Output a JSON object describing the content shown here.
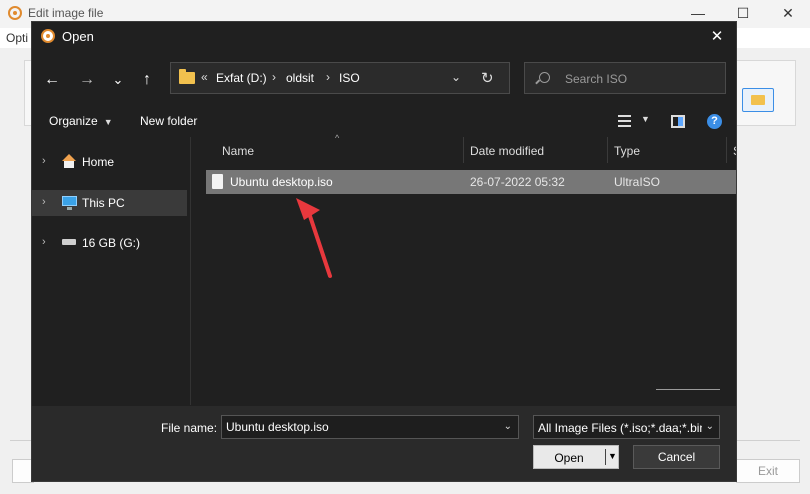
{
  "parent_window": {
    "title": "Edit image file",
    "menu_label": "Opti",
    "exit_label": "Exit",
    "minimize": "—",
    "maximize": "☐",
    "close": "✕"
  },
  "dialog": {
    "title": "Open",
    "close": "✕",
    "nav": {
      "back": "←",
      "forward": "→",
      "recent": "⌄",
      "up": "↑"
    },
    "address": {
      "overflow": "«",
      "crumbs": [
        "Exfat (D:)",
        "oldsit",
        "ISO"
      ],
      "sep": "›",
      "dropdown": "⌄",
      "refresh": "↻"
    },
    "search": {
      "placeholder": "Search ISO"
    },
    "toolbar": {
      "organize": "Organize",
      "new_folder": "New folder",
      "help": "?"
    },
    "nav_pane": [
      {
        "label": "Home",
        "icon": "home-icon",
        "selected": false
      },
      {
        "label": "This PC",
        "icon": "computer-icon",
        "selected": true
      },
      {
        "label": "16 GB (G:)",
        "icon": "drive-icon",
        "selected": false
      }
    ],
    "chevron": "›",
    "columns": {
      "name": "Name",
      "date": "Date modified",
      "type": "Type",
      "size": "S"
    },
    "sort_indicator": "^",
    "files": [
      {
        "name": "Ubuntu desktop.iso",
        "date": "26-07-2022 05:32",
        "type": "UltraISO"
      }
    ],
    "footer": {
      "file_name_label": "File name:",
      "file_name_value": "Ubuntu desktop.iso",
      "file_type_value": "All Image Files (*.iso;*.daa;*.bin",
      "open_label": "Open",
      "cancel_label": "Cancel",
      "dropdown": "⌄"
    }
  },
  "colors": {
    "dialog_bg": "#202020",
    "selected_row": "#777777",
    "accent_blue": "#3b8ee6",
    "folder_yellow": "#f2c14e",
    "annotation_red": "#e8383d"
  }
}
